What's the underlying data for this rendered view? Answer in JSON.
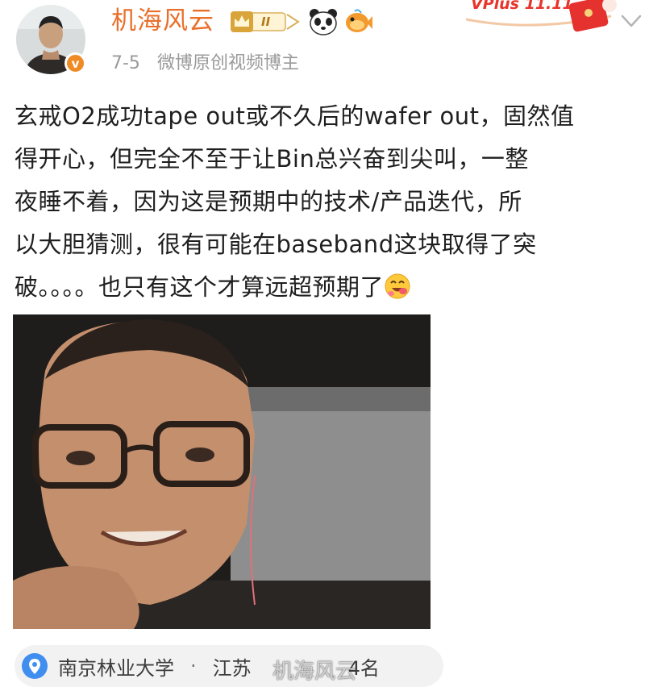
{
  "user": {
    "name": "机海风云",
    "level_badge": "II",
    "verified_badge": "v",
    "date": "7-5",
    "description": "微博原创视频博主"
  },
  "promo": {
    "label": "VPlus 11.11"
  },
  "post": {
    "lines": [
      "玄戒O2成功tape out或不久后的wafer out，固然值",
      "得开心，但完全不至于让Bin总兴奋到尖叫，一整",
      "夜睡不着，因为这是预期中的技术/产品迭代，所",
      "以大胆猜测，很有可能在baseband这块取得了突",
      "破。。。。也只有这个才算远超预期了"
    ]
  },
  "location": {
    "place": "南京林业大学",
    "separator": "·",
    "region": "江苏",
    "rank": "4名"
  },
  "watermark": "机海风云",
  "colors": {
    "username": "#e96f2a",
    "meta": "#9a9a9a",
    "accent_orange": "#f08a24",
    "promo_red": "#e8352c"
  },
  "icons": [
    "verified-v-icon",
    "crown-level-icon",
    "panda-icon",
    "fish-icon",
    "chevron-down-icon",
    "drool-emoji-icon",
    "location-pin-icon"
  ]
}
